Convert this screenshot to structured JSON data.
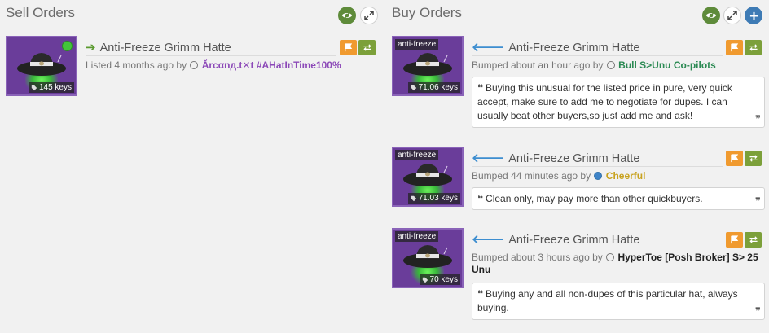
{
  "sell": {
    "title": "Sell Orders",
    "toggle_icon": "eye-icon",
    "expand_icon": "expand-icon",
    "listing": {
      "item_name": "Anti-Freeze Grimm Hatte",
      "price": "145 keys",
      "online": true,
      "meta_prefix": "Listed 4 months ago by",
      "user": "Ărcαnд.t✕t #AHatInTime100%",
      "user_color": "#8c49b8"
    }
  },
  "buy": {
    "title": "Buy Orders",
    "toggle_icon": "eye-icon",
    "expand_icon": "expand-icon",
    "add_icon": "plus-icon",
    "listings": [
      {
        "tag": "anti-freeze",
        "item_name": "Anti-Freeze Grimm Hatte",
        "price": "71.06 keys",
        "meta_prefix": "Bumped about an hour ago by",
        "user": "Bull S>Unu Co-pilots",
        "user_color": "#2b8a53",
        "comment": "Buying this unusual for the listed price in pure, very quick accept, make sure to add me to negotiate for dupes. I can usually beat other buyers,so just add me and ask!"
      },
      {
        "tag": "anti-freeze",
        "item_name": "Anti-Freeze Grimm Hatte",
        "price": "71.03 keys",
        "meta_prefix": "Bumped 44 minutes ago by",
        "user": "Cheerful",
        "user_color": "#c8a21e",
        "comment": "Clean only, may pay more than other quickbuyers."
      },
      {
        "tag": "anti-freeze",
        "item_name": "Anti-Freeze Grimm Hatte",
        "price": "70 keys",
        "meta_prefix": "Bumped about 3 hours ago by",
        "user": "HyperToe [Posh Broker] S> 25 Unu",
        "user_color": "#222222",
        "comment": "Buying any and all non-dupes of this particular hat, always buying."
      }
    ]
  },
  "colors": {
    "background": "#f1f1f1",
    "item_box": "#6a3d9a",
    "report_button": "#f09a2f",
    "trade_button": "#7ca03a",
    "toggle_button": "#5e8b3a",
    "add_button": "#3e7bb5"
  },
  "icons": {
    "sell_arrow": "arrow-right-icon",
    "buy_arrow": "arrow-left-icon",
    "report": "flag-icon",
    "trade": "exchange-icon",
    "price_tag": "tag-icon",
    "quote_open": "quote-open-icon",
    "quote_close": "quote-close-icon"
  }
}
